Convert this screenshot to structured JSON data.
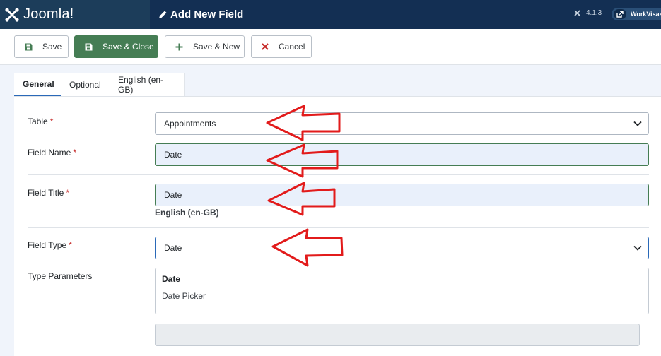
{
  "header": {
    "brand": "Joomla!",
    "page_title": "Add New Field",
    "version": "4.1.3",
    "site_name": "WorkVisas"
  },
  "toolbar": {
    "save_label": "Save",
    "save_close_label": "Save & Close",
    "save_new_label": "Save & New",
    "cancel_label": "Cancel"
  },
  "tabs": [
    {
      "label": "General",
      "active": true
    },
    {
      "label": "Optional",
      "active": false
    },
    {
      "label": "English (en-GB)",
      "active": false
    }
  ],
  "form": {
    "table": {
      "label": "Table",
      "required_mark": "*",
      "value": "Appointments"
    },
    "field_name": {
      "label": "Field Name",
      "required_mark": "*",
      "value": "Date"
    },
    "field_title": {
      "label": "Field Title",
      "required_mark": "*",
      "value": "Date",
      "language_note": "English (en-GB)"
    },
    "field_type": {
      "label": "Field Type",
      "required_mark": "*",
      "value": "Date"
    },
    "type_parameters": {
      "label": "Type Parameters",
      "title": "Date",
      "description": "Date Picker"
    }
  },
  "colors": {
    "header_bg": "#132f53",
    "primary_green": "#457d54",
    "required_red": "#c52827",
    "annotation_red": "#e21b1b",
    "tab_active_underline": "#2a69b8"
  }
}
